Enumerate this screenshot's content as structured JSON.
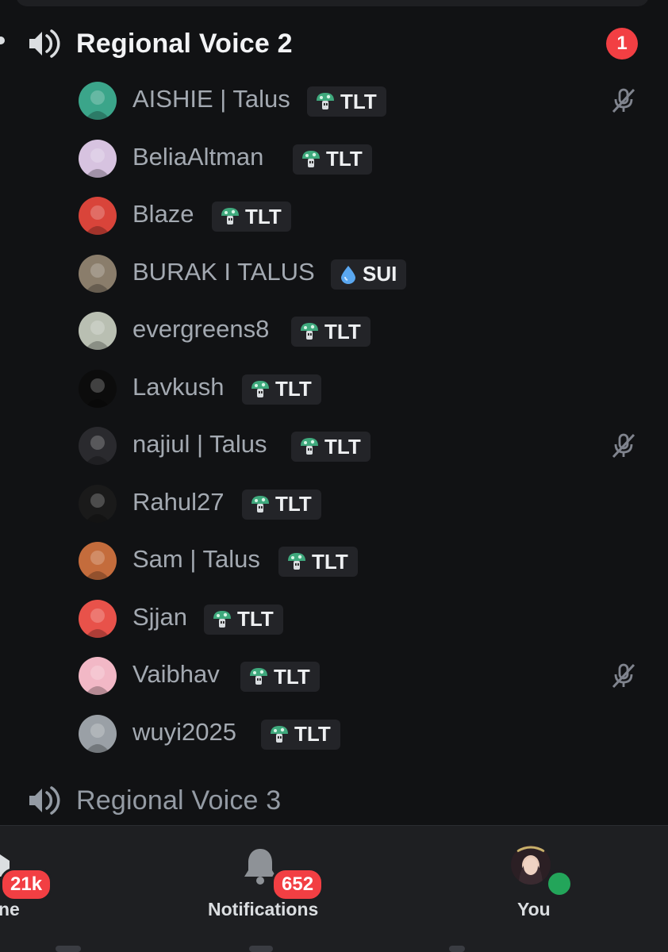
{
  "channels": {
    "current": {
      "name": "Regional Voice 2",
      "mention_count": "1",
      "icon": "speaker-icon"
    },
    "next": {
      "name": "Regional Voice 3",
      "icon": "speaker-icon"
    }
  },
  "users": [
    {
      "name": "AISHIE | Talus",
      "tag": "TLT",
      "tag_icon": "mushroom-icon",
      "muted": true,
      "avatar_color": "#3ba58a"
    },
    {
      "name": "BeliaAltman",
      "tag": "TLT",
      "tag_icon": "mushroom-icon",
      "muted": false,
      "avatar_color": "#d7c3e0"
    },
    {
      "name": "Blaze",
      "tag": "TLT",
      "tag_icon": "mushroom-icon",
      "muted": false,
      "avatar_color": "#d9443a"
    },
    {
      "name": "BURAK I TALUS",
      "tag": "SUI",
      "tag_icon": "water-drop-icon",
      "muted": false,
      "avatar_color": "#8a7d6b"
    },
    {
      "name": "evergreens8",
      "tag": "TLT",
      "tag_icon": "mushroom-icon",
      "muted": false,
      "avatar_color": "#b9bfb2"
    },
    {
      "name": "Lavkush",
      "tag": "TLT",
      "tag_icon": "mushroom-icon",
      "muted": false,
      "avatar_color": "#0c0c0c"
    },
    {
      "name": "najiul | Talus",
      "tag": "TLT",
      "tag_icon": "mushroom-icon",
      "muted": true,
      "avatar_color": "#2a2a2e"
    },
    {
      "name": "Rahul27",
      "tag": "TLT",
      "tag_icon": "mushroom-icon",
      "muted": false,
      "avatar_color": "#1a1a1a"
    },
    {
      "name": "Sam | Talus",
      "tag": "TLT",
      "tag_icon": "mushroom-icon",
      "muted": false,
      "avatar_color": "#c46c3c"
    },
    {
      "name": "Sjjan",
      "tag": "TLT",
      "tag_icon": "mushroom-icon",
      "muted": false,
      "avatar_color": "#e8524a"
    },
    {
      "name": "Vaibhav",
      "tag": "TLT",
      "tag_icon": "mushroom-icon",
      "muted": true,
      "avatar_color": "#f2b8c6"
    },
    {
      "name": "wuyi2025",
      "tag": "TLT",
      "tag_icon": "mushroom-icon",
      "muted": false,
      "avatar_color": "#9aa0a6"
    }
  ],
  "bottom_nav": {
    "home": {
      "label": "ne",
      "badge": "21k",
      "icon": "home-icon"
    },
    "notifications": {
      "label": "Notifications",
      "badge": "652",
      "icon": "bell-icon"
    },
    "you": {
      "label": "You",
      "icon": "avatar",
      "status": "online"
    }
  },
  "colors": {
    "background": "#111214",
    "nav_background": "#1e1f22",
    "badge_red": "#f23f43",
    "online_green": "#23a55a",
    "tag_green": "#3fa97d",
    "sui_blue": "#5aa7f0"
  }
}
